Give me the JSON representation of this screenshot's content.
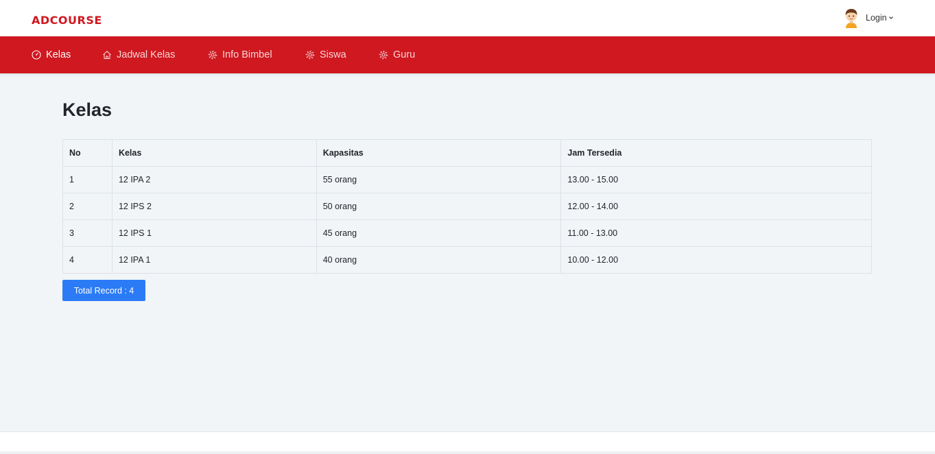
{
  "header": {
    "brand": "ADCOURSE",
    "user": {
      "label": "Login",
      "avatar_icon": "user-avatar-icon"
    }
  },
  "nav": {
    "items": [
      {
        "label": "Kelas",
        "icon": "gauge-icon",
        "active": true
      },
      {
        "label": "Jadwal Kelas",
        "icon": "home-icon",
        "active": false
      },
      {
        "label": "Info Bimbel",
        "icon": "gear-icon",
        "active": false
      },
      {
        "label": "Siswa",
        "icon": "gear-icon",
        "active": false
      },
      {
        "label": "Guru",
        "icon": "gear-icon",
        "active": false
      }
    ]
  },
  "main": {
    "title": "Kelas",
    "table": {
      "headers": [
        "No",
        "Kelas",
        "Kapasitas",
        "Jam Tersedia"
      ],
      "rows": [
        [
          "1",
          "12 IPA 2",
          "55 orang",
          "13.00 - 15.00"
        ],
        [
          "2",
          "12 IPS 2",
          "50 orang",
          "12.00 - 14.00"
        ],
        [
          "3",
          "12 IPS 1",
          "45 orang",
          "11.00 - 13.00"
        ],
        [
          "4",
          "12 IPA 1",
          "40 orang",
          "10.00 - 12.00"
        ]
      ]
    },
    "total_label": "Total Record : 4"
  },
  "colors": {
    "brand_red": "#cf1820",
    "button_blue": "#2b7bf6",
    "background": "#f1f5f8"
  }
}
